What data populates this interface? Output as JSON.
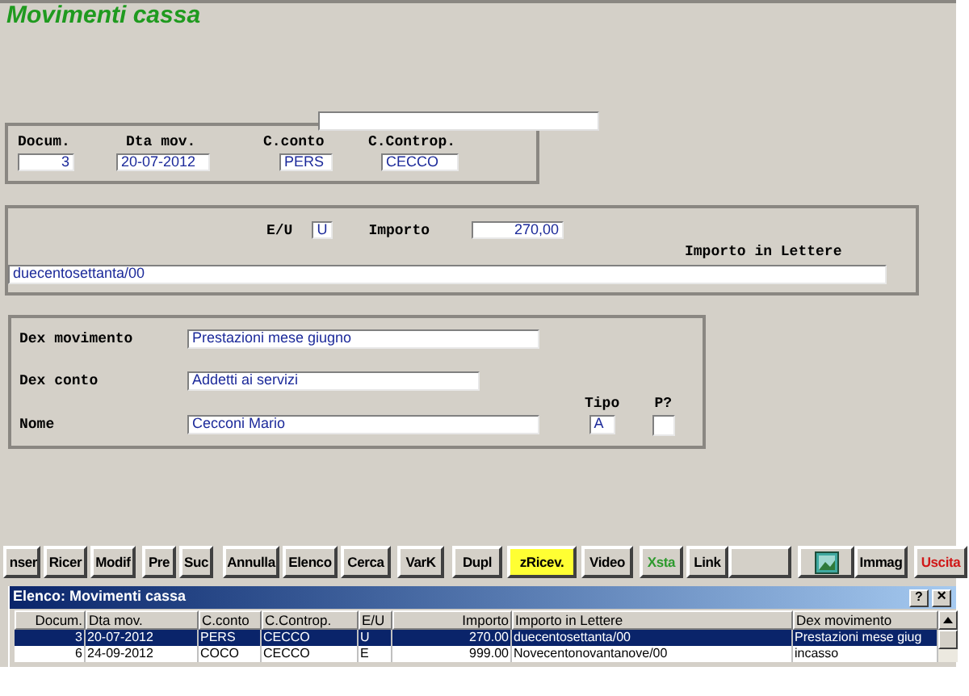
{
  "window": {
    "title": "Movimenti cassa"
  },
  "document": {
    "fields": [
      {
        "label": "Docum.",
        "value": "3"
      },
      {
        "label": "Dta mov.",
        "value": "20-07-2012"
      },
      {
        "label": "C.conto",
        "value": "PERS"
      },
      {
        "label": "C.Controp.",
        "value": "CECCO"
      }
    ]
  },
  "amount": {
    "eu_label": "E/U",
    "eu_value": "U",
    "importo_label": "Importo",
    "importo_value": "270,00",
    "lettere_label": "Importo in Lettere",
    "lettere_value": "duecentosettanta/00"
  },
  "details": {
    "fields": [
      {
        "label": "Dex movimento",
        "value": "Prestazioni mese giugno"
      },
      {
        "label": "Dex conto",
        "value": "Addetti ai servizi"
      },
      {
        "label": "Nome",
        "value": "Cecconi Mario"
      }
    ],
    "tipo_label": "Tipo",
    "tipo_value": "A",
    "p_label": "P?"
  },
  "toolbar": [
    {
      "kind": "text",
      "label": "nser"
    },
    {
      "kind": "text",
      "label": "Ricer"
    },
    {
      "kind": "text",
      "label": "Modif"
    },
    {
      "kind": "text",
      "label": "Pre"
    },
    {
      "kind": "text",
      "label": "Suc"
    },
    {
      "kind": "text",
      "label": "Annulla"
    },
    {
      "kind": "text",
      "label": "Elenco"
    },
    {
      "kind": "text",
      "label": "Cerca"
    },
    {
      "kind": "text",
      "label": "VarK"
    },
    {
      "kind": "text",
      "label": "Dupl"
    },
    {
      "kind": "text",
      "label": "zRicev.",
      "highlight": true
    },
    {
      "kind": "text",
      "label": "Video"
    },
    {
      "kind": "text",
      "label": "Xsta",
      "color": "#2e9a2e"
    },
    {
      "kind": "text",
      "label": "Link"
    },
    {
      "kind": "blank"
    },
    {
      "kind": "icon"
    },
    {
      "kind": "text",
      "label": "Immag"
    },
    {
      "kind": "text",
      "label": "Uscita",
      "color": "#d01818"
    }
  ],
  "list_window": {
    "title": "Elenco: Movimenti cassa",
    "help": "?",
    "close": "×",
    "columns": [
      "Docum.",
      "Dta mov.",
      "C.conto",
      "C.Controp.",
      "E/U",
      "Importo",
      "Importo in Lettere",
      "Dex movimento"
    ],
    "rows": [
      {
        "selected": true,
        "cells": [
          "3",
          "20-07-2012",
          "PERS",
          "CECCO",
          "U",
          "270.00",
          "duecentosettanta/00",
          "Prestazioni mese giug"
        ]
      },
      {
        "selected": false,
        "cells": [
          "6",
          "24-09-2012",
          "COCO",
          "CECCO",
          "E",
          "999.00",
          "Novecentonovantanove/00",
          "incasso"
        ]
      }
    ]
  }
}
